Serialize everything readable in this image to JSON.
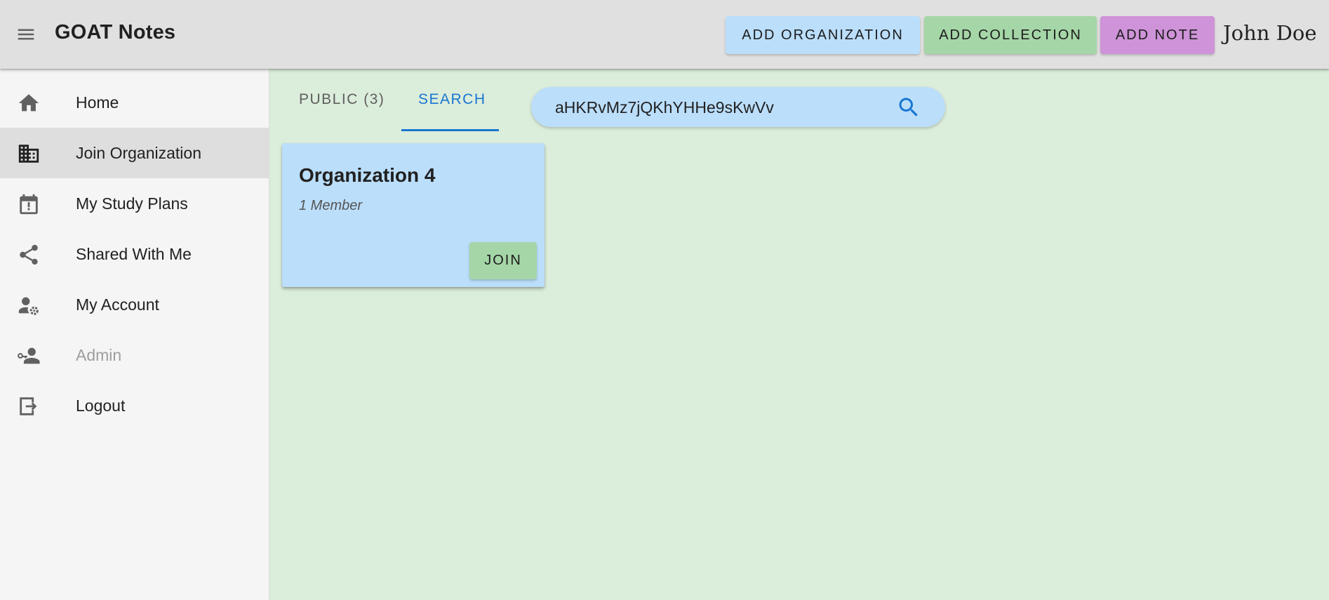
{
  "app": {
    "title": "GOAT Notes",
    "menu_icon": "hamburger-menu-icon"
  },
  "header": {
    "buttons": [
      {
        "label": "ADD ORGANIZATION",
        "color": "#bbdefb"
      },
      {
        "label": "ADD COLLECTION",
        "color": "#a5d6a7"
      },
      {
        "label": "ADD NOTE",
        "color": "#ce93d8"
      }
    ],
    "user_name": "John Doe"
  },
  "sidebar": {
    "items": [
      {
        "label": "Home",
        "icon": "home-icon",
        "active": false,
        "disabled": false
      },
      {
        "label": "Join Organization",
        "icon": "building-icon",
        "active": true,
        "disabled": false
      },
      {
        "label": "My Study Plans",
        "icon": "calendar-alert-icon",
        "active": false,
        "disabled": false
      },
      {
        "label": "Shared With Me",
        "icon": "share-icon",
        "active": false,
        "disabled": false
      },
      {
        "label": "My Account",
        "icon": "account-settings-icon",
        "active": false,
        "disabled": false
      },
      {
        "label": "Admin",
        "icon": "admin-key-icon",
        "active": false,
        "disabled": true
      },
      {
        "label": "Logout",
        "icon": "logout-icon",
        "active": false,
        "disabled": false
      }
    ]
  },
  "main": {
    "tabs": [
      {
        "label": "PUBLIC (3)",
        "selected": false
      },
      {
        "label": "SEARCH",
        "selected": true
      }
    ],
    "search": {
      "value": "aHKRvMz7jQKhYHHe9sKwVv",
      "icon": "search-icon"
    },
    "results": [
      {
        "name": "Organization 4",
        "members": "1 Member",
        "action": "JOIN"
      }
    ]
  },
  "colors": {
    "accent": "#1976d2",
    "background": "#dbeddb",
    "card": "#bbdefb",
    "join": "#a5d6a7"
  }
}
